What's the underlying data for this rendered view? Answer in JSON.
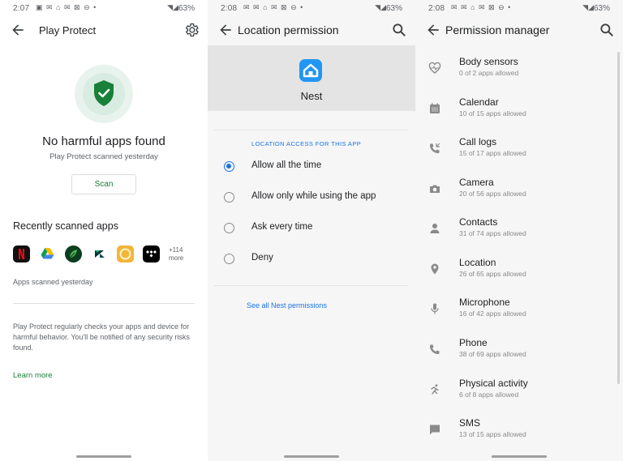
{
  "panel1": {
    "status": {
      "time": "2:07",
      "icons": "▣ ✉ ⌂ ✉ ⊠ ⊖ •",
      "battery": "63%"
    },
    "title": "Play Protect",
    "heading": "No harmful apps found",
    "subheading": "Play Protect scanned yesterday",
    "scan_label": "Scan",
    "recent_title": "Recently scanned apps",
    "apps": [
      "netflix-icon",
      "google-drive-icon",
      "leaf-app-icon",
      "zendesk-icon",
      "gold-ring-app-icon",
      "tidal-icon"
    ],
    "more_count": "+114",
    "more_label": "more",
    "scanned_note": "Apps scanned yesterday",
    "description": "Play Protect regularly checks your apps and device for harmful behavior. You'll be notified of any security risks found.",
    "learn_more": "Learn more",
    "accent": "#188038"
  },
  "panel2": {
    "status": {
      "time": "2:08",
      "icons": "✉ ✉ ⌂ ✉ ⊠ ⊖ •",
      "battery": "63%"
    },
    "title": "Location permission",
    "app_name": "Nest",
    "caption": "LOCATION ACCESS FOR THIS APP",
    "options": [
      {
        "label": "Allow all the time",
        "selected": true
      },
      {
        "label": "Allow only while using the app",
        "selected": false
      },
      {
        "label": "Ask every time",
        "selected": false
      },
      {
        "label": "Deny",
        "selected": false
      }
    ],
    "link": "See all Nest permissions",
    "accent": "#1a73e8"
  },
  "panel3": {
    "status": {
      "time": "2:08",
      "icons": "✉ ✉ ⌂ ✉ ⊠ ⊖ •",
      "battery": "63%"
    },
    "title": "Permission manager",
    "items": [
      {
        "name": "Body sensors",
        "sub": "0 of 2 apps allowed",
        "icon": "heart-pulse-icon"
      },
      {
        "name": "Calendar",
        "sub": "10 of 15 apps allowed",
        "icon": "calendar-icon"
      },
      {
        "name": "Call logs",
        "sub": "15 of 17 apps allowed",
        "icon": "call-log-icon"
      },
      {
        "name": "Camera",
        "sub": "20 of 56 apps allowed",
        "icon": "camera-icon"
      },
      {
        "name": "Contacts",
        "sub": "31 of 74 apps allowed",
        "icon": "person-icon"
      },
      {
        "name": "Location",
        "sub": "26 of 65 apps allowed",
        "icon": "location-pin-icon"
      },
      {
        "name": "Microphone",
        "sub": "16 of 42 apps allowed",
        "icon": "microphone-icon"
      },
      {
        "name": "Phone",
        "sub": "38 of 69 apps allowed",
        "icon": "phone-icon"
      },
      {
        "name": "Physical activity",
        "sub": "6 of 8 apps allowed",
        "icon": "running-icon"
      },
      {
        "name": "SMS",
        "sub": "13 of 15 apps allowed",
        "icon": "message-icon"
      }
    ]
  }
}
